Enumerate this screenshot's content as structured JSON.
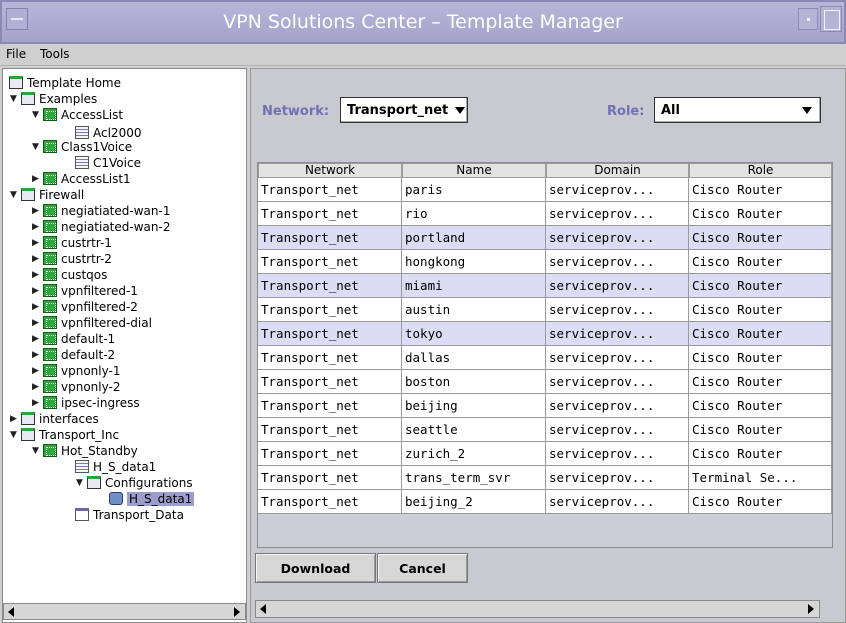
{
  "window": {
    "title": "VPN Solutions Center – Template Manager"
  },
  "menubar": {
    "file": "File",
    "tools": "Tools"
  },
  "tree": [
    {
      "label": "Template Home",
      "icon": "folder-icon",
      "expander": ""
    },
    {
      "label": "Examples",
      "icon": "folder-icon",
      "expander": "expanded"
    },
    {
      "label": "AccessList",
      "icon": "template-icon",
      "expander": "expanded"
    },
    {
      "label": "Acl2000",
      "icon": "document-icon",
      "expander": ""
    },
    {
      "label": "Class1Voice",
      "icon": "template-icon",
      "expander": "expanded"
    },
    {
      "label": "C1Voice",
      "icon": "document-icon",
      "expander": ""
    },
    {
      "label": "AccessList1",
      "icon": "template-icon",
      "expander": "collapsed"
    },
    {
      "label": "Firewall",
      "icon": "folder-icon",
      "expander": "expanded"
    },
    {
      "label": "negiatiated-wan-1",
      "icon": "template-icon",
      "expander": "collapsed"
    },
    {
      "label": "negiatiated-wan-2",
      "icon": "template-icon",
      "expander": "collapsed"
    },
    {
      "label": "custrtr-1",
      "icon": "template-icon",
      "expander": "collapsed"
    },
    {
      "label": "custrtr-2",
      "icon": "template-icon",
      "expander": "collapsed"
    },
    {
      "label": "custqos",
      "icon": "template-icon",
      "expander": "collapsed"
    },
    {
      "label": "vpnfiltered-1",
      "icon": "template-icon",
      "expander": "collapsed"
    },
    {
      "label": "vpnfiltered-2",
      "icon": "template-icon",
      "expander": "collapsed"
    },
    {
      "label": "vpnfiltered-dial",
      "icon": "template-icon",
      "expander": "collapsed"
    },
    {
      "label": "default-1",
      "icon": "template-icon",
      "expander": "collapsed"
    },
    {
      "label": "default-2",
      "icon": "template-icon",
      "expander": "collapsed"
    },
    {
      "label": "vpnonly-1",
      "icon": "template-icon",
      "expander": "collapsed"
    },
    {
      "label": "vpnonly-2",
      "icon": "template-icon",
      "expander": "collapsed"
    },
    {
      "label": "ipsec-ingress",
      "icon": "template-icon",
      "expander": "collapsed"
    },
    {
      "label": "interfaces",
      "icon": "folder-icon",
      "expander": "collapsed"
    },
    {
      "label": "Transport_Inc",
      "icon": "folder-icon",
      "expander": "expanded"
    },
    {
      "label": "Hot_Standby",
      "icon": "template-icon",
      "expander": "expanded"
    },
    {
      "label": "H_S_data1",
      "icon": "document-icon",
      "expander": ""
    },
    {
      "label": "Configurations",
      "icon": "folder-icon",
      "expander": "expanded"
    },
    {
      "label": "H_S_data1",
      "icon": "datafile-icon",
      "expander": "",
      "selected": true
    },
    {
      "label": "Transport_Data",
      "icon": "data-icon",
      "expander": ""
    }
  ],
  "filters": {
    "network_label": "Network:",
    "network_value": "Transport_net",
    "role_label": "Role:",
    "role_value": "All"
  },
  "table": {
    "columns": [
      "Network",
      "Name",
      "Domain",
      "Role"
    ],
    "rows": [
      {
        "network": "Transport_net",
        "name": "paris",
        "domain": "serviceprov...",
        "role": "Cisco Router",
        "highlight": false
      },
      {
        "network": "Transport_net",
        "name": "rio",
        "domain": "serviceprov...",
        "role": "Cisco Router",
        "highlight": false
      },
      {
        "network": "Transport_net",
        "name": "portland",
        "domain": "serviceprov...",
        "role": "Cisco Router",
        "highlight": true
      },
      {
        "network": "Transport_net",
        "name": "hongkong",
        "domain": "serviceprov...",
        "role": "Cisco Router",
        "highlight": false
      },
      {
        "network": "Transport_net",
        "name": "miami",
        "domain": "serviceprov...",
        "role": "Cisco Router",
        "highlight": true
      },
      {
        "network": "Transport_net",
        "name": "austin",
        "domain": "serviceprov...",
        "role": "Cisco Router",
        "highlight": false
      },
      {
        "network": "Transport_net",
        "name": "tokyo",
        "domain": "serviceprov...",
        "role": "Cisco Router",
        "highlight": true
      },
      {
        "network": "Transport_net",
        "name": "dallas",
        "domain": "serviceprov...",
        "role": "Cisco Router",
        "highlight": false
      },
      {
        "network": "Transport_net",
        "name": "boston",
        "domain": "serviceprov...",
        "role": "Cisco Router",
        "highlight": false
      },
      {
        "network": "Transport_net",
        "name": "beijing",
        "domain": "serviceprov...",
        "role": "Cisco Router",
        "highlight": false
      },
      {
        "network": "Transport_net",
        "name": "seattle",
        "domain": "serviceprov...",
        "role": "Cisco Router",
        "highlight": false
      },
      {
        "network": "Transport_net",
        "name": "zurich_2",
        "domain": "serviceprov...",
        "role": "Cisco Router",
        "highlight": false
      },
      {
        "network": "Transport_net",
        "name": "trans_term_svr",
        "domain": "serviceprov...",
        "role": "Terminal Se...",
        "highlight": false
      },
      {
        "network": "Transport_net",
        "name": "beijing_2",
        "domain": "serviceprov...",
        "role": "Cisco Router",
        "highlight": false
      }
    ]
  },
  "buttons": {
    "download": "Download",
    "cancel": "Cancel"
  },
  "colors": {
    "titlebar": "#a8a8cf",
    "row_highlight": "#dcdcf4",
    "label_blue": "#7070b4",
    "template_icon": "#2ea83a"
  }
}
